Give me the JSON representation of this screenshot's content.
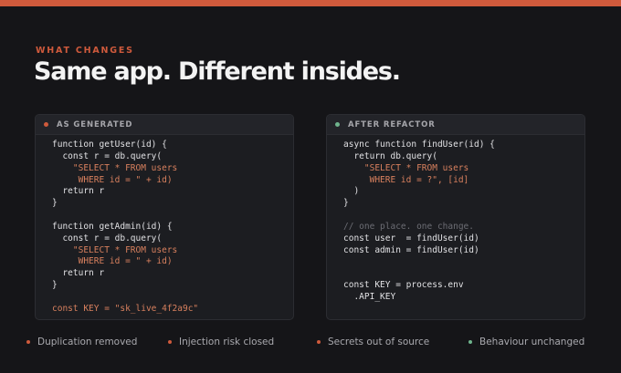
{
  "colors": {
    "accent": "#cf5a3c",
    "positive": "#6fb48d",
    "background": "#151518",
    "panel": "#1c1d21"
  },
  "header": {
    "eyebrow": "WHAT CHANGES",
    "title": "Same app. Different insides."
  },
  "panels": {
    "before": {
      "title": "AS GENERATED",
      "status": "orange-dot",
      "lines": [
        {
          "text": "function getUser(id) {",
          "kind": "code"
        },
        {
          "text": "  const r = db.query(",
          "kind": "code"
        },
        {
          "text": "    \"SELECT * FROM users",
          "kind": "string"
        },
        {
          "text": "     WHERE id = \" + id)",
          "kind": "string"
        },
        {
          "text": "  return r",
          "kind": "code"
        },
        {
          "text": "}",
          "kind": "code"
        },
        {
          "text": "",
          "kind": "code"
        },
        {
          "text": "function getAdmin(id) {",
          "kind": "code"
        },
        {
          "text": "  const r = db.query(",
          "kind": "code"
        },
        {
          "text": "    \"SELECT * FROM users",
          "kind": "string"
        },
        {
          "text": "     WHERE id = \" + id)",
          "kind": "string"
        },
        {
          "text": "  return r",
          "kind": "code"
        },
        {
          "text": "}",
          "kind": "code"
        },
        {
          "text": "",
          "kind": "code"
        },
        {
          "text": "const KEY = \"sk_live_4f2a9c\"",
          "kind": "secret"
        }
      ]
    },
    "after": {
      "title": "AFTER REFACTOR",
      "status": "green-dot",
      "lines": [
        {
          "text": "async function findUser(id) {",
          "kind": "code"
        },
        {
          "text": "  return db.query(",
          "kind": "code"
        },
        {
          "text": "    \"SELECT * FROM users",
          "kind": "string"
        },
        {
          "text": "     WHERE id = ?\", [id]",
          "kind": "string"
        },
        {
          "text": "  )",
          "kind": "code"
        },
        {
          "text": "}",
          "kind": "code"
        },
        {
          "text": "",
          "kind": "code"
        },
        {
          "text": "// one place. one change.",
          "kind": "comment"
        },
        {
          "text": "const user  = findUser(id)",
          "kind": "code"
        },
        {
          "text": "const admin = findUser(id)",
          "kind": "code"
        },
        {
          "text": "",
          "kind": "code"
        },
        {
          "text": "",
          "kind": "code"
        },
        {
          "text": "const KEY = process.env",
          "kind": "code"
        },
        {
          "text": "  .API_KEY",
          "kind": "code"
        }
      ]
    }
  },
  "legend": [
    {
      "label": "Duplication removed",
      "color": "#cf5a3c"
    },
    {
      "label": "Injection risk closed",
      "color": "#cf5a3c"
    },
    {
      "label": "Secrets out of source",
      "color": "#cf5a3c"
    },
    {
      "label": "Behaviour unchanged",
      "color": "#6fb48d"
    }
  ]
}
